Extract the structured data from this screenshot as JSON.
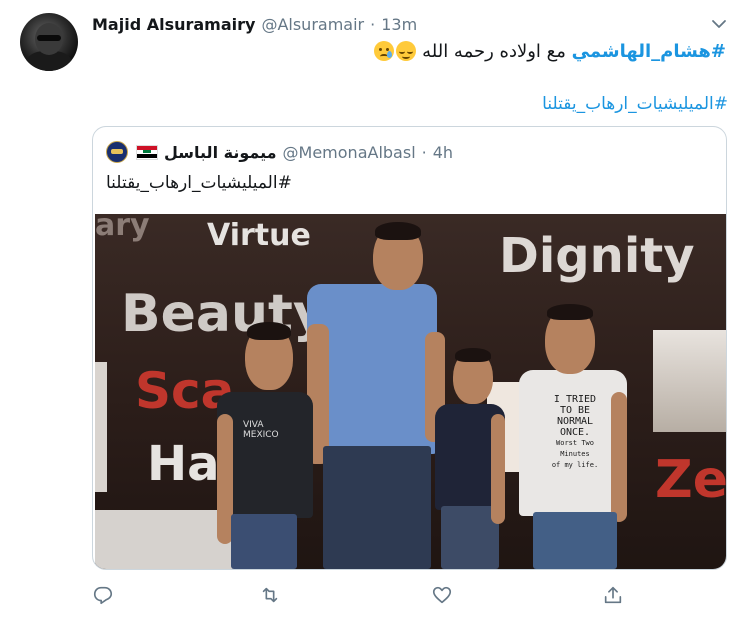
{
  "tweet": {
    "author_name": "Majid Alsuramairy",
    "author_handle": "@Alsuramair",
    "separator": "·",
    "time": "13m",
    "hashtag1": "#هشام_الهاشمي",
    "text1": "مع اولاده رحمه الله",
    "hashtag2": "#الميليشيات_ارهاب_يقتلنا"
  },
  "quoted": {
    "author_name": "ميمونة الباسل",
    "author_handle": "@MemonaAlbasl",
    "separator": "·",
    "time": "4h",
    "text": "#الميليشيات_ارهاب_يقتلنا",
    "photo_words": {
      "w1": "Virtue",
      "w2": "Dignity",
      "w3": "Beauty",
      "w4": "Sca",
      "w5": "Ha",
      "w6": "Ze",
      "w7": "ary"
    },
    "shirt_text": {
      "left": "VIVA MEXICO",
      "right_1": "I TRIED",
      "right_2": "TO BE",
      "right_3": "NORMAL",
      "right_4": "ONCE.",
      "right_5": "Worst Two",
      "right_6": "Minutes",
      "right_7": "of my life."
    }
  },
  "icons": {
    "reply": "reply-icon",
    "retweet": "retweet-icon",
    "like": "heart-icon",
    "share": "share-icon",
    "menu": "chevron-down-icon"
  },
  "colors": {
    "link": "#1b95e0",
    "secondary_text": "#657786",
    "border": "#ccd6dd"
  }
}
